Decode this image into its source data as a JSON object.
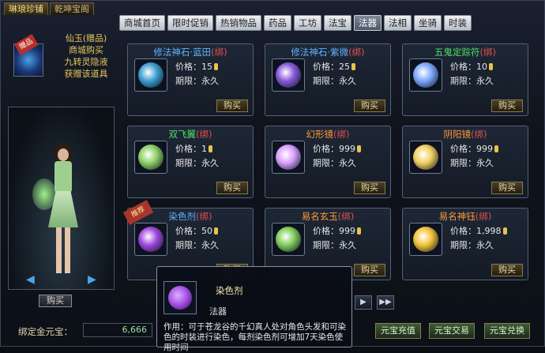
{
  "store_tabs": [
    "琳琅珍铺",
    "乾坤宝阁"
  ],
  "categories": [
    "商城首页",
    "限时促销",
    "热销物品",
    "药品",
    "工坊",
    "法宝",
    "法器",
    "法相",
    "坐骑",
    "时装"
  ],
  "active_category": "法器",
  "promo": {
    "ribbon": "赠品",
    "lines": [
      "仙玉(赠品)",
      "商城购买",
      "九转灵隐液",
      "获赠该道具"
    ]
  },
  "preview": {
    "buy_label": "购买"
  },
  "items": [
    {
      "name": "修法神石·蓝田",
      "bind": "(绑)",
      "name_color": "#5fb4ff",
      "price": "价格：15",
      "expire": "期限：永久",
      "buy": "购买",
      "gem": "#3fa0d0",
      "tag": ""
    },
    {
      "name": "修法神石·紫微",
      "bind": "(绑)",
      "name_color": "#5fb4ff",
      "price": "价格：25",
      "expire": "期限：永久",
      "buy": "购买",
      "gem": "#8a5ad8",
      "tag": ""
    },
    {
      "name": "五鬼定踪符",
      "bind": "(绑)",
      "name_color": "#4fe06a",
      "price": "价格：10",
      "expire": "期限：永久",
      "buy": "购买",
      "gem": "#7fa8ff",
      "tag": ""
    },
    {
      "name": "双飞翼",
      "bind": "(绑)",
      "name_color": "#4fe06a",
      "price": "价格：1",
      "expire": "期限：永久",
      "buy": "购买",
      "gem": "#8fd06a",
      "tag": ""
    },
    {
      "name": "幻形镜",
      "bind": "(绑)",
      "name_color": "#ff9a3a",
      "price": "价格：999",
      "expire": "期限：永久",
      "buy": "购买",
      "gem": "#d8a0ff",
      "tag": ""
    },
    {
      "name": "阴阳镜",
      "bind": "(绑)",
      "name_color": "#ff9a3a",
      "price": "价格：999",
      "expire": "期限：永久",
      "buy": "购买",
      "gem": "#f0d060",
      "tag": ""
    },
    {
      "name": "染色剂",
      "bind": "(绑)",
      "name_color": "#5fb4ff",
      "price": "价格：50",
      "expire": "期限：永久",
      "buy": "购买",
      "gem": "#a04ae0",
      "tag": "推荐"
    },
    {
      "name": "易名玄玉",
      "bind": "(绑)",
      "name_color": "#ff9a3a",
      "price": "价格：999",
      "expire": "期限：永久",
      "buy": "购买",
      "gem": "#7fce5a",
      "tag": ""
    },
    {
      "name": "易名神钰",
      "bind": "(绑)",
      "name_color": "#ff9a3a",
      "price": "价格：1,998",
      "expire": "期限：永久",
      "buy": "购买",
      "gem": "#f2c33a",
      "tag": ""
    }
  ],
  "pager": {
    "next": "▶",
    "last": "▶▶"
  },
  "bottom": {
    "bound_label": "绑定金元宝：",
    "bound_value": "6,666",
    "buttons": [
      "元宝充值",
      "元宝交易",
      "元宝兑换"
    ]
  },
  "tooltip": {
    "name": "染色剂",
    "type": "法器",
    "desc": "作用：可于苍龙谷的千幻真人处对角色头发和可染色的时装进行染色，每剂染色剂可增加7天染色使用时间"
  }
}
